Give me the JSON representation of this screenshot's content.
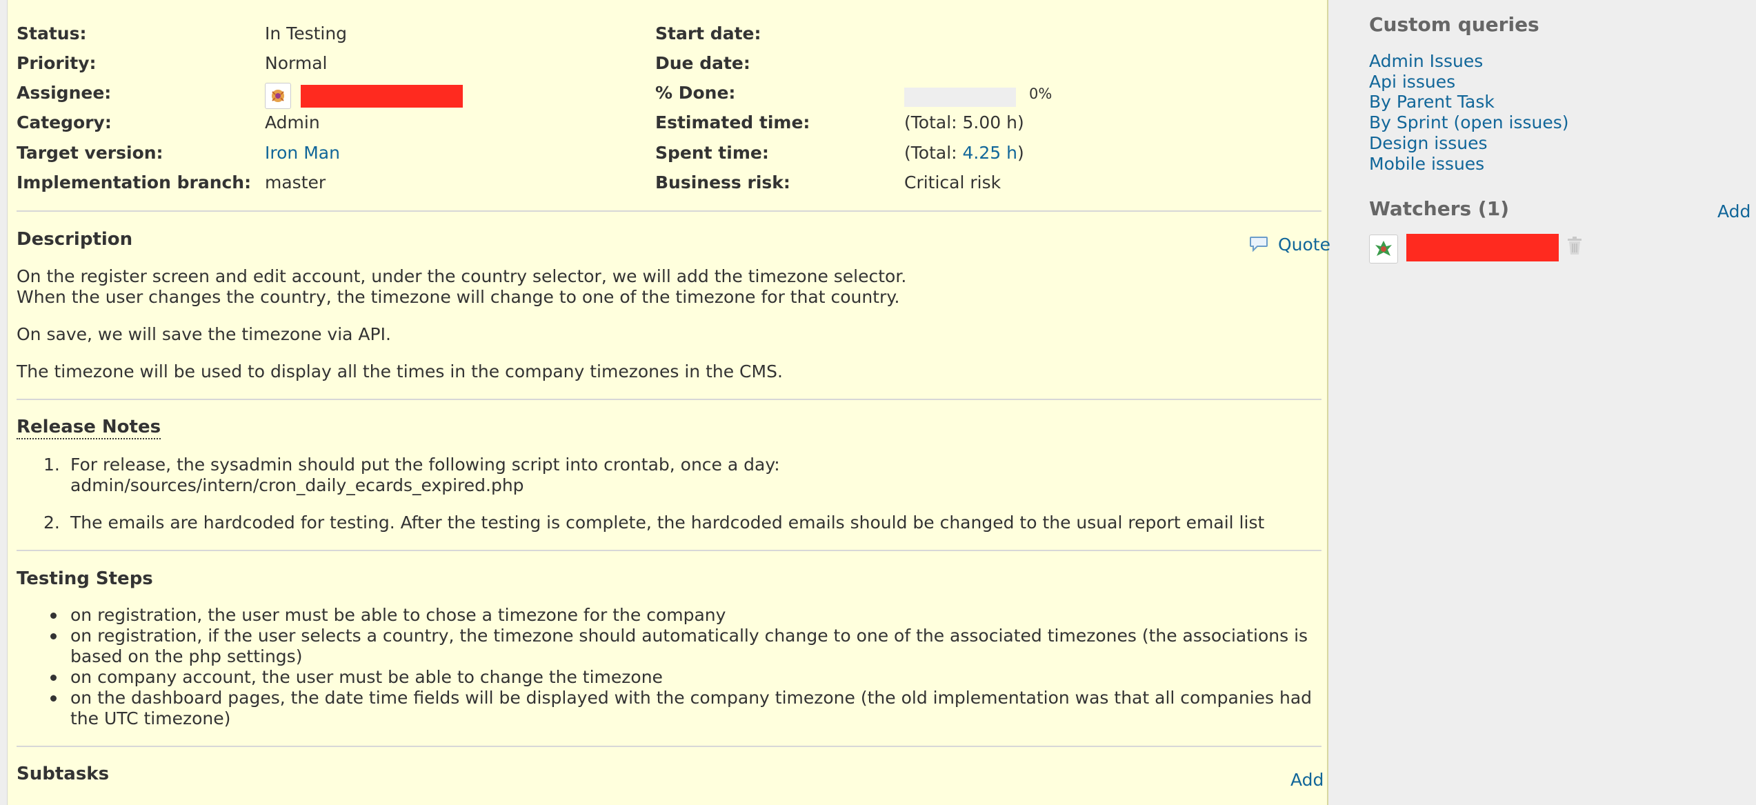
{
  "attributes": {
    "status": {
      "label": "Status:",
      "value": "In Testing"
    },
    "priority": {
      "label": "Priority:",
      "value": "Normal"
    },
    "assignee": {
      "label": "Assignee:"
    },
    "category": {
      "label": "Category:",
      "value": "Admin"
    },
    "target_version": {
      "label": "Target version:",
      "value": "Iron Man"
    },
    "implementation_branch": {
      "label": "Implementation branch:",
      "value": "master"
    },
    "start_date": {
      "label": "Start date:",
      "value": ""
    },
    "due_date": {
      "label": "Due date:",
      "value": ""
    },
    "done": {
      "label": "% Done:",
      "value": "0%",
      "progress": 0
    },
    "estimated_time": {
      "label": "Estimated time:",
      "value": "(Total: 5.00 h)"
    },
    "spent_time": {
      "label": "Spent time:",
      "prefix": "(Total: ",
      "value": "4.25 h",
      "suffix": ")"
    },
    "business_risk": {
      "label": "Business risk:",
      "value": "Critical risk"
    }
  },
  "description": {
    "title": "Description",
    "quote_label": "Quote",
    "lines": [
      "On the register screen and edit account, under the country selector, we will add the timezone selector.",
      "When the user changes the country, the timezone will change to one of the timezone for that country.",
      "On save, we will save the timezone via API.",
      "The timezone will be used to display all the times in the company timezones in the CMS."
    ]
  },
  "release_notes": {
    "title": "Release Notes",
    "items": [
      {
        "num": "1.",
        "lines": [
          "For release, the sysadmin should put the following script into crontab, once a day:",
          "admin/sources/intern/cron_daily_ecards_expired.php"
        ]
      },
      {
        "num": "2.",
        "lines": [
          "The emails are hardcoded for testing. After the testing is complete, the hardcoded emails should be changed to the usual report email list"
        ]
      }
    ]
  },
  "testing_steps": {
    "title": "Testing Steps",
    "items": [
      "on registration, the user must be able to chose a timezone for the company",
      "on registration, if the user selects a country, the timezone should automatically change to one of the associated timezones (the associations is based on the php settings)",
      "on company account, the user must be able to change the timezone",
      "on the dashboard pages, the date time fields will be displayed with the company timezone (the old implementation was that all companies had the UTC timezone)"
    ]
  },
  "subtasks": {
    "title": "Subtasks",
    "add_label": "Add"
  },
  "sidebar": {
    "custom_queries": {
      "title": "Custom queries",
      "items": [
        "Admin Issues",
        "Api issues",
        "By Parent Task",
        "By Sprint (open issues)",
        "Design issues",
        "Mobile issues"
      ]
    },
    "watchers": {
      "title": "Watchers (1)",
      "add_label": "Add"
    }
  },
  "colors": {
    "panel_bg": "#ffffdd",
    "sidebar_bg": "#eeeeee",
    "link": "#116699",
    "redaction": "#ff2a1f"
  },
  "icons": [
    "comment-icon",
    "delete-icon",
    "avatar-icon"
  ]
}
